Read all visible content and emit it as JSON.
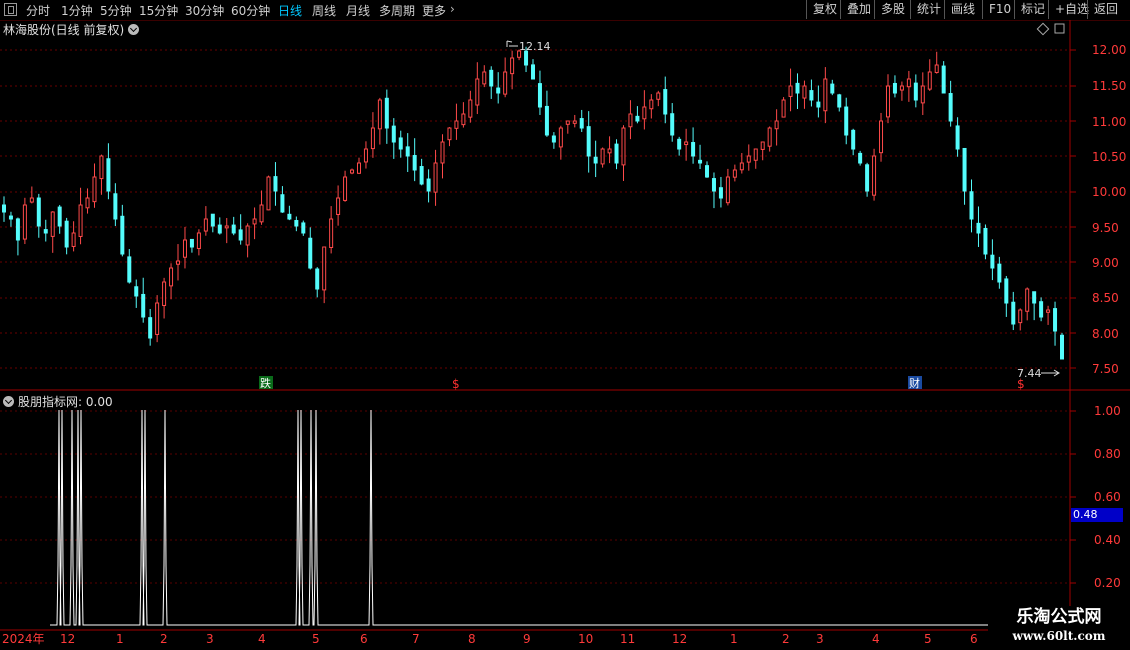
{
  "toolbar": {
    "periods": [
      "分时",
      "1分钟",
      "5分钟",
      "15分钟",
      "30分钟",
      "60分钟",
      "日线",
      "周线",
      "月线",
      "多周期",
      "更多"
    ],
    "active_period": "日线",
    "right_buttons": [
      "复权",
      "叠加",
      "多股",
      "统计",
      "画线",
      "F10",
      "标记",
      "+自选",
      "返回"
    ]
  },
  "chart_title": "林海股份(日线 前复权)",
  "price_axis": {
    "ticks": [
      "12.00",
      "11.50",
      "11.00",
      "10.50",
      "10.00",
      "9.50",
      "9.00",
      "8.50",
      "8.00",
      "7.50"
    ],
    "high_label": "12.14",
    "low_label": "7.44"
  },
  "markers": {
    "m1": "跌",
    "m2": "$",
    "m3": "$",
    "m4": "财"
  },
  "indicator": {
    "title": "股朋指标网",
    "value": ": 0.00",
    "ticks": [
      "1.00",
      "0.80",
      "0.60",
      "0.40",
      "0.20"
    ],
    "current_box": "0.48"
  },
  "time_axis": [
    "2024年",
    "12",
    "1",
    "2",
    "3",
    "4",
    "5",
    "6",
    "7",
    "8",
    "9",
    "10",
    "11",
    "12",
    "1",
    "2",
    "3",
    "4",
    "5",
    "6"
  ],
  "watermark": {
    "line1": "乐淘公式网",
    "line2": "www.60lt.com"
  },
  "colors": {
    "up": "#ff4a4a",
    "down": "#54fcfc",
    "grid": "#7a0000",
    "axis": "#a00000",
    "active": "#00c8ff"
  },
  "chart_data": {
    "type": "candlestick",
    "price_range": [
      7.3,
      12.3
    ],
    "closes": [
      9.7,
      9.6,
      9.3,
      9.8,
      9.9,
      9.5,
      9.4,
      9.7,
      9.5,
      9.2,
      9.4,
      9.8,
      9.9,
      10.2,
      10.5,
      10.0,
      9.6,
      9.1,
      8.7,
      8.5,
      8.2,
      7.9,
      8.4,
      8.7,
      8.9,
      9.0,
      9.3,
      9.2,
      9.4,
      9.6,
      9.5,
      9.4,
      9.5,
      9.4,
      9.3,
      9.5,
      9.6,
      9.8,
      10.2,
      10.0,
      9.7,
      9.6,
      9.5,
      9.4,
      8.9,
      8.6,
      9.2,
      9.6,
      9.9,
      10.2,
      10.3,
      10.4,
      10.6,
      10.9,
      11.3,
      10.9,
      10.7,
      10.6,
      10.5,
      10.3,
      10.1,
      10.0,
      10.4,
      10.7,
      10.9,
      11.0,
      11.1,
      11.3,
      11.6,
      11.7,
      11.5,
      11.4,
      11.7,
      11.9,
      12.0,
      11.8,
      11.6,
      11.2,
      10.8,
      10.7,
      10.9,
      11.0,
      11.0,
      10.9,
      10.5,
      10.4,
      10.6,
      10.6,
      10.4,
      10.9,
      11.1,
      11.0,
      11.2,
      11.3,
      11.4,
      11.1,
      10.8,
      10.6,
      10.7,
      10.5,
      10.4,
      10.2,
      10.0,
      9.9,
      10.2,
      10.3,
      10.4,
      10.5,
      10.6,
      10.7,
      10.9,
      11.0,
      11.3,
      11.5,
      11.4,
      11.5,
      11.3,
      11.2,
      11.6,
      11.4,
      11.2,
      10.8,
      10.6,
      10.4,
      10.0,
      10.5,
      11.0,
      11.5,
      11.4,
      11.5,
      11.6,
      11.3,
      11.5,
      11.7,
      11.8,
      11.4,
      11.0,
      10.6,
      10.0,
      9.6,
      9.4,
      9.1,
      8.9,
      8.7,
      8.4,
      8.1,
      8.3,
      8.6,
      8.4,
      8.2,
      8.3,
      8.0,
      7.6
    ]
  }
}
